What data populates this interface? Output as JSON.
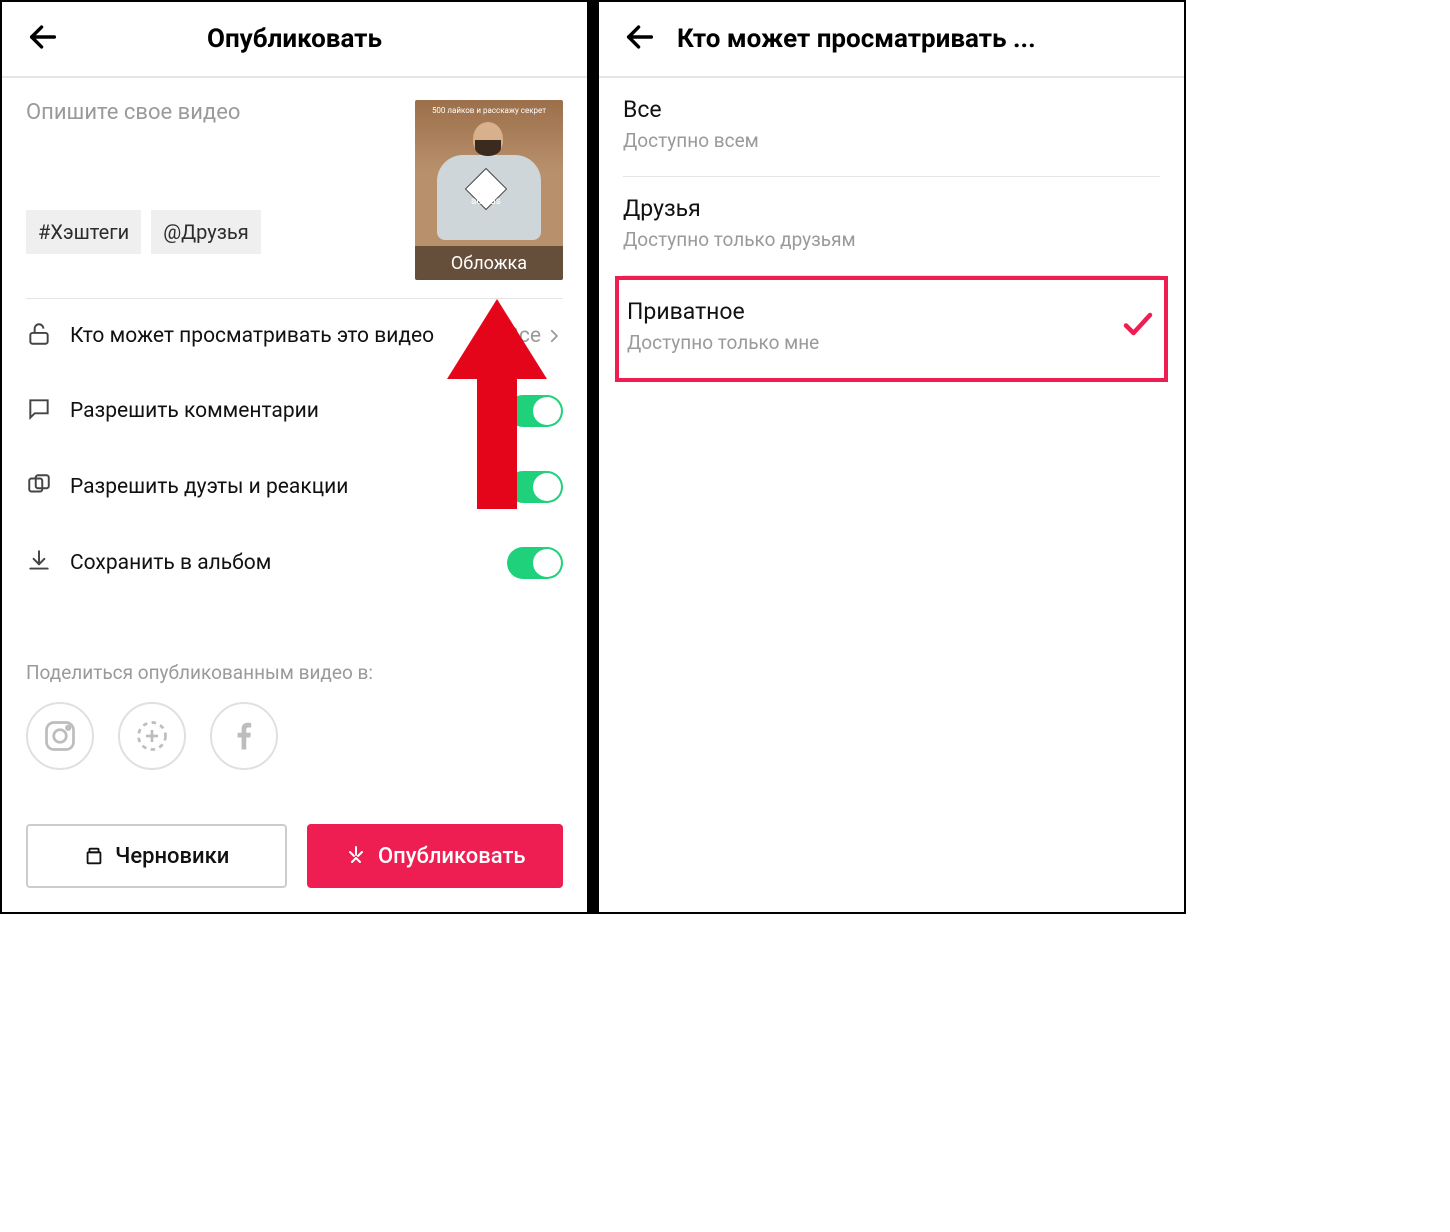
{
  "left": {
    "title": "Опубликовать",
    "description_placeholder": "Опишите свое видео",
    "hashtag_chip": "#Хэштеги",
    "friends_chip": "@Друзья",
    "thumb_caption": "Обложка",
    "thumb_overlay_text": "500 лайков и расскажу секрет",
    "thumb_logo": "adidas",
    "settings": {
      "privacy": {
        "label": "Кто может просматривать это видео",
        "value": "Все"
      },
      "comments_label": "Разрешить комментарии",
      "duets_label": "Разрешить дуэты и реакции",
      "save_label": "Сохранить в альбом"
    },
    "share_label": "Поделиться опубликованным видео в:",
    "drafts_button": "Черновики",
    "publish_button": "Опубликовать"
  },
  "right": {
    "title": "Кто может просматривать ...",
    "options": [
      {
        "title": "Все",
        "subtitle": "Доступно всем",
        "selected": false,
        "highlighted": false
      },
      {
        "title": "Друзья",
        "subtitle": "Доступно только друзьям",
        "selected": false,
        "highlighted": false
      },
      {
        "title": "Приватное",
        "subtitle": "Доступно только мне",
        "selected": true,
        "highlighted": true
      }
    ]
  }
}
